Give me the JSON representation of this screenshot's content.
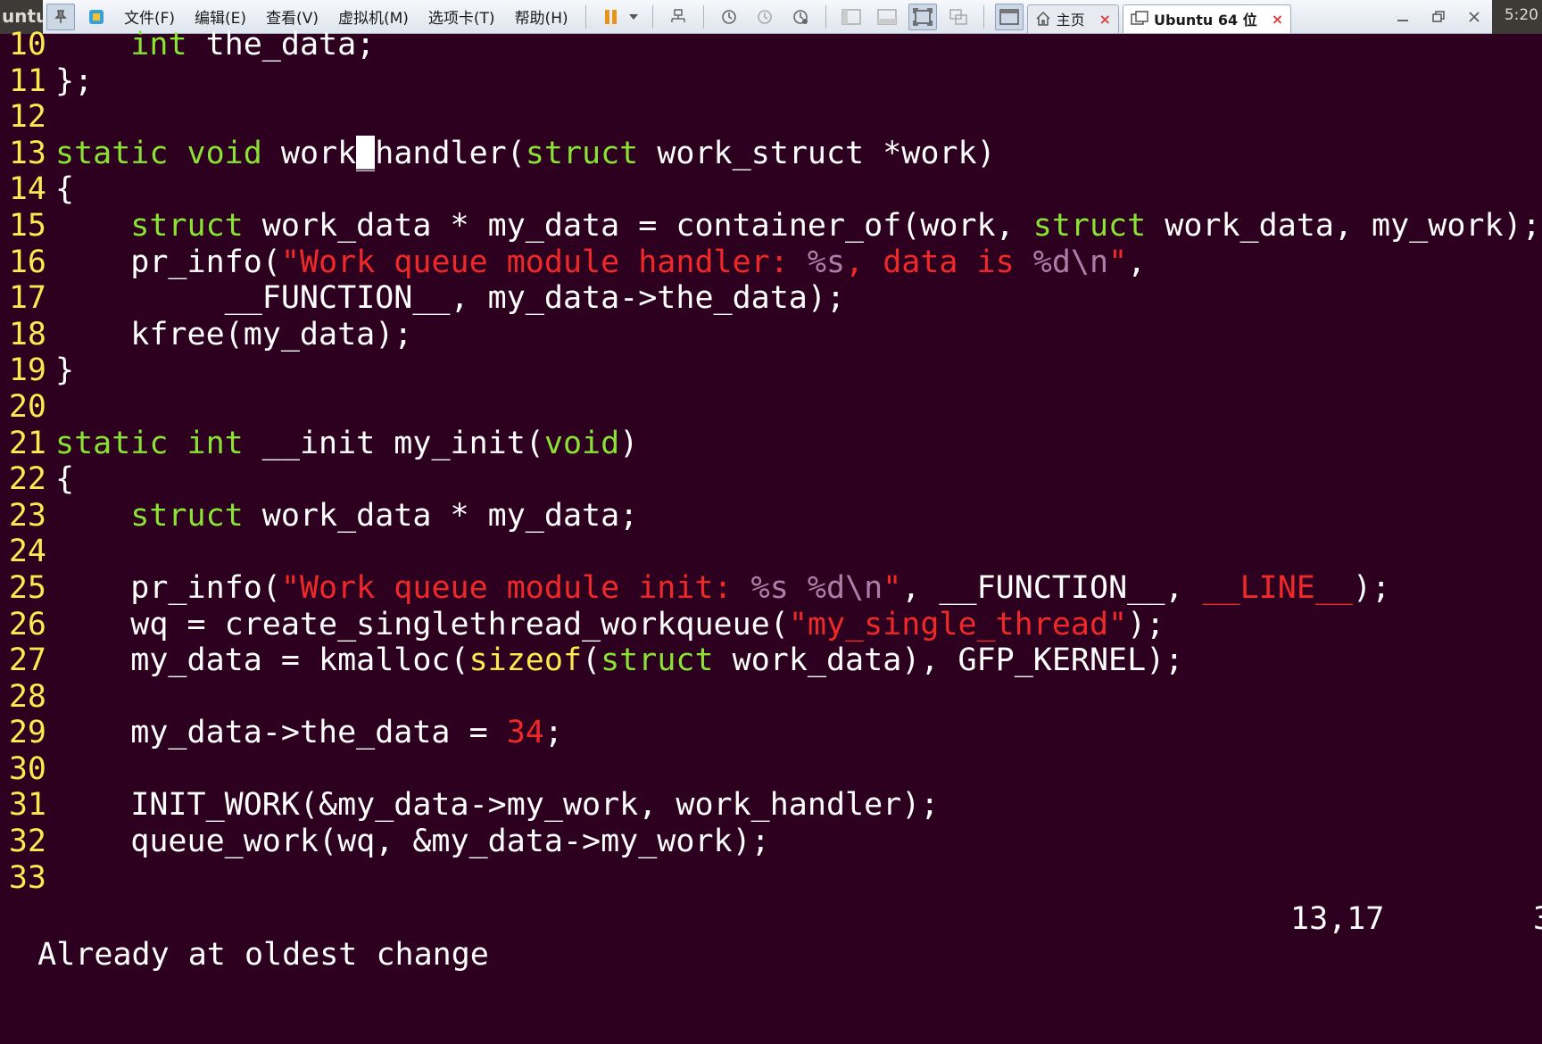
{
  "desktop": {
    "app_label": "untu",
    "clock": "5:20"
  },
  "toolbar": {
    "menus": [
      "文件(F)",
      "编辑(E)",
      "查看(V)",
      "虚拟机(M)",
      "选项卡(T)",
      "帮助(H)"
    ],
    "tabs": [
      {
        "label": "主页",
        "icon": "home-icon",
        "selected": false
      },
      {
        "label": "Ubuntu 64 位",
        "icon": "vm-icon",
        "selected": true
      }
    ],
    "close_glyph": "×"
  },
  "editor": {
    "lines": [
      {
        "n": "10",
        "text": "    int the_data;"
      },
      {
        "n": "11",
        "text": "};"
      },
      {
        "n": "12",
        "text": ""
      },
      {
        "n": "13",
        "text": "static void work_handler(struct work_struct *work)"
      },
      {
        "n": "14",
        "text": "{"
      },
      {
        "n": "15",
        "text": "    struct work_data * my_data = container_of(work, struct work_data, my_work);"
      },
      {
        "n": "16",
        "text": "    pr_info(\"Work queue module handler: %s, data is %d\\n\","
      },
      {
        "n": "17",
        "text": "         __FUNCTION__, my_data->the_data);"
      },
      {
        "n": "18",
        "text": "    kfree(my_data);"
      },
      {
        "n": "19",
        "text": "}"
      },
      {
        "n": "20",
        "text": ""
      },
      {
        "n": "21",
        "text": "static int __init my_init(void)"
      },
      {
        "n": "22",
        "text": "{"
      },
      {
        "n": "23",
        "text": "    struct work_data * my_data;"
      },
      {
        "n": "24",
        "text": ""
      },
      {
        "n": "25",
        "text": "    pr_info(\"Work queue module init: %s %d\\n\", __FUNCTION__, __LINE__);"
      },
      {
        "n": "26",
        "text": "    wq = create_singlethread_workqueue(\"my_single_thread\");"
      },
      {
        "n": "27",
        "text": "    my_data = kmalloc(sizeof(struct work_data), GFP_KERNEL);"
      },
      {
        "n": "28",
        "text": ""
      },
      {
        "n": "29",
        "text": "    my_data->the_data = 34;"
      },
      {
        "n": "30",
        "text": ""
      },
      {
        "n": "31",
        "text": "    INIT_WORK(&my_data->my_work, work_handler);"
      },
      {
        "n": "32",
        "text": "    queue_work(wq, &my_data->my_work);"
      },
      {
        "n": "33",
        "text": ""
      }
    ],
    "cursor": {
      "line": "13",
      "col": "17"
    }
  },
  "status": {
    "message": "Already at oldest change",
    "position": "13,17",
    "right_fragment": "3"
  },
  "colors": {
    "background": "#2c001e",
    "line_number": "#fce94f",
    "keyword": "#8ae234",
    "string": "#ef2929",
    "format_spec": "#ad7fa8",
    "text": "#ffffff"
  }
}
